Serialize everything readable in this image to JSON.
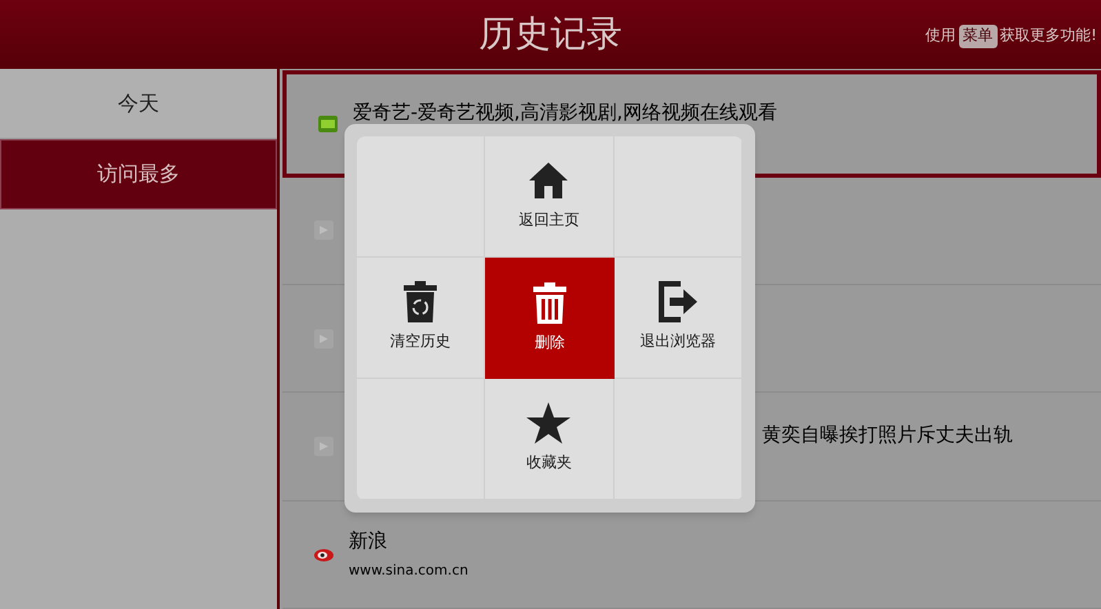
{
  "header": {
    "title": "历史记录",
    "hint_before": "使用",
    "hint_key": "菜单",
    "hint_after": "获取更多功能!"
  },
  "sidebar": {
    "items": [
      {
        "label": "今天",
        "selected": false
      },
      {
        "label": "访问最多",
        "selected": true
      }
    ]
  },
  "history": [
    {
      "kind": "video",
      "title": "爱奇艺-爱奇艺视频,高清影视剧,网络视频在线观看",
      "selected": true
    },
    {
      "kind": "site",
      "selected": false
    },
    {
      "kind": "site",
      "selected": false
    },
    {
      "kind": "site",
      "title_tail": "黄奕自曝挨打照片斥丈夫出轨",
      "selected": false
    },
    {
      "kind": "weibo",
      "title": "新浪",
      "url": "www.sina.com.cn",
      "selected": false
    }
  ],
  "menu": [
    {
      "kind": "empty"
    },
    {
      "kind": "home",
      "label": "返回主页",
      "selected": false
    },
    {
      "kind": "empty"
    },
    {
      "kind": "clear",
      "label": "清空历史",
      "selected": false
    },
    {
      "kind": "delete",
      "label": "删除",
      "selected": true
    },
    {
      "kind": "exit",
      "label": "退出浏览器",
      "selected": false
    },
    {
      "kind": "empty"
    },
    {
      "kind": "star",
      "label": "收藏夹",
      "selected": false
    },
    {
      "kind": "empty"
    }
  ]
}
